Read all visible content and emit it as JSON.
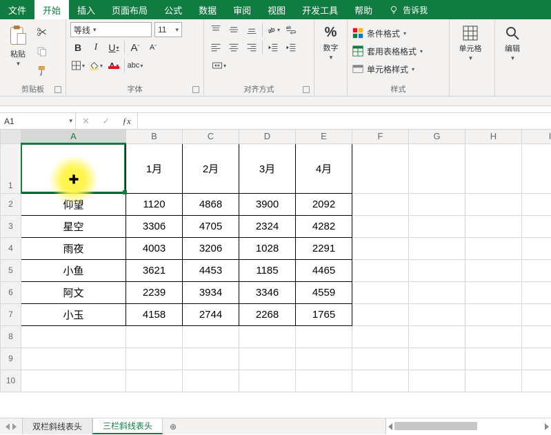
{
  "tabs": {
    "items": [
      {
        "label": "文件"
      },
      {
        "label": "开始",
        "active": true
      },
      {
        "label": "插入"
      },
      {
        "label": "页面布局"
      },
      {
        "label": "公式"
      },
      {
        "label": "数据"
      },
      {
        "label": "审阅"
      },
      {
        "label": "视图"
      },
      {
        "label": "开发工具"
      },
      {
        "label": "帮助"
      }
    ],
    "tellme": "告诉我"
  },
  "ribbon": {
    "clipboard": {
      "label": "剪贴板",
      "paste": "粘贴"
    },
    "font": {
      "label": "字体",
      "name": "等线",
      "size": "11",
      "bold": "B",
      "italic": "I",
      "underline": "U",
      "grow": "A",
      "shrink": "A"
    },
    "alignment": {
      "label": "对齐方式"
    },
    "number": {
      "label": "数字",
      "pct": "%"
    },
    "styles": {
      "label": "样式",
      "cond": "条件格式",
      "table": "套用表格格式",
      "cell": "单元格样式"
    },
    "cells": {
      "label": "单元格"
    },
    "editing": {
      "label": "编辑"
    }
  },
  "namebox": {
    "value": "A1"
  },
  "grid": {
    "columns": [
      "A",
      "B",
      "C",
      "D",
      "E",
      "F",
      "G",
      "H",
      "I"
    ],
    "row_numbers": [
      "1",
      "2",
      "3",
      "4",
      "5",
      "6",
      "7",
      "8",
      "9",
      "10"
    ],
    "headers": [
      "1月",
      "2月",
      "3月",
      "4月"
    ],
    "rows": [
      {
        "name": "仰望",
        "v": [
          "1120",
          "4868",
          "3900",
          "2092"
        ]
      },
      {
        "name": "星空",
        "v": [
          "3306",
          "4705",
          "2324",
          "4282"
        ]
      },
      {
        "name": "雨夜",
        "v": [
          "4003",
          "3206",
          "1028",
          "2291"
        ]
      },
      {
        "name": "小鱼",
        "v": [
          "3621",
          "4453",
          "1185",
          "4465"
        ]
      },
      {
        "name": "阿文",
        "v": [
          "2239",
          "3934",
          "3346",
          "4559"
        ]
      },
      {
        "name": "小玉",
        "v": [
          "4158",
          "2744",
          "2268",
          "1765"
        ]
      }
    ]
  },
  "sheets": {
    "items": [
      {
        "label": "双栏斜线表头"
      },
      {
        "label": "三栏斜线表头",
        "active": true
      }
    ]
  },
  "colors": {
    "accent": "#107c41",
    "highlight": "#fff550"
  }
}
